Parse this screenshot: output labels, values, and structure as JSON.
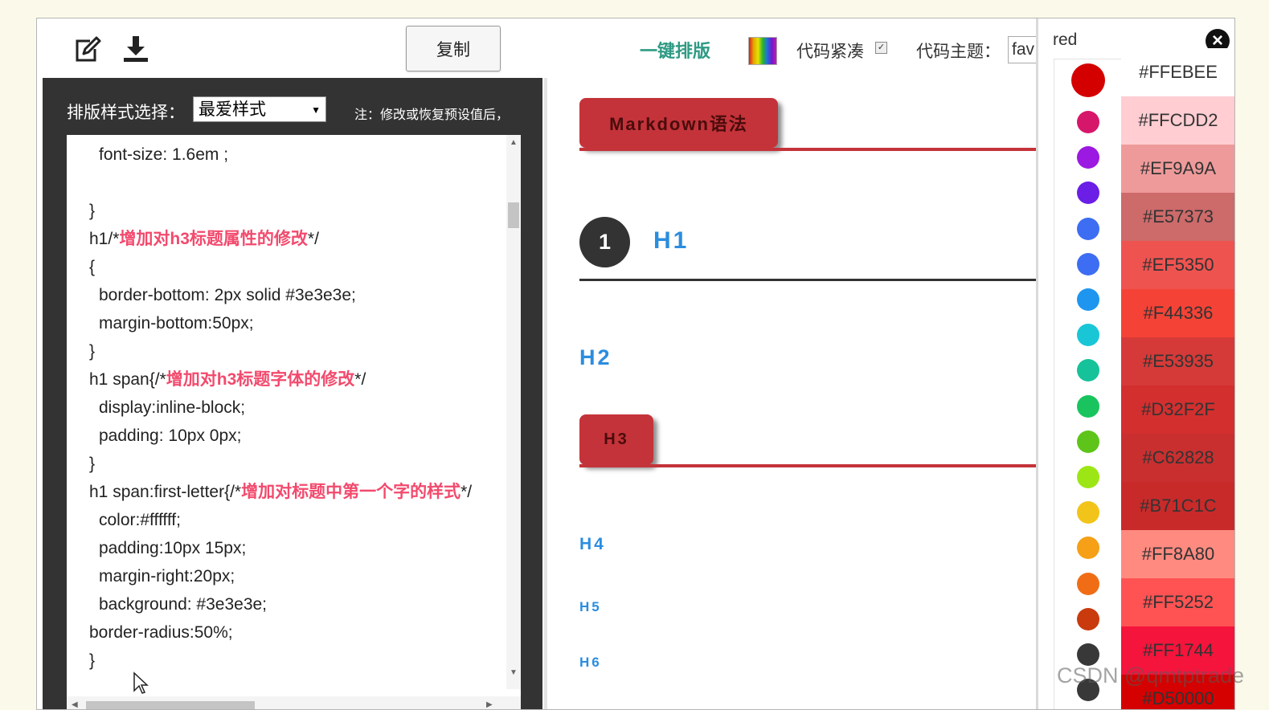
{
  "toolbar": {
    "edit_icon": "edit-icon",
    "download_icon": "download-icon",
    "copy_label": "复制",
    "one_key_label": "一键排版",
    "palette_icon": "palette-icon",
    "compact_label": "代码紧凑",
    "compact_checked": true,
    "theme_label": "代码主题：",
    "theme_value": "fav"
  },
  "editor": {
    "style_label": "排版样式选择：",
    "style_value": "最爱样式",
    "note": "注：修改或恢复预设值后，",
    "code_lines": [
      {
        "pre": "  font-size: 1.6em  ;",
        "red": "",
        "post": ""
      },
      {
        "pre": "",
        "red": "",
        "post": ""
      },
      {
        "pre": "}",
        "red": "",
        "post": ""
      },
      {
        "pre": "h1/*",
        "red": "增加对h3标题属性的修改",
        "post": "*/"
      },
      {
        "pre": "{",
        "red": "",
        "post": ""
      },
      {
        "pre": "  border-bottom: 2px solid #3e3e3e;",
        "red": "",
        "post": ""
      },
      {
        "pre": "  margin-bottom:50px;",
        "red": "",
        "post": ""
      },
      {
        "pre": "}",
        "red": "",
        "post": ""
      },
      {
        "pre": "h1 span{/*",
        "red": "增加对h3标题字体的修改",
        "post": "*/"
      },
      {
        "pre": "  display:inline-block;",
        "red": "",
        "post": ""
      },
      {
        "pre": "  padding:  10px  0px;",
        "red": "",
        "post": ""
      },
      {
        "pre": "}",
        "red": "",
        "post": ""
      },
      {
        "pre": "h1 span:first-letter{/*",
        "red": "增加对标题中第一个字的样式",
        "post": "*/"
      },
      {
        "pre": "  color:#ffffff;",
        "red": "",
        "post": ""
      },
      {
        "pre": "  padding:10px 15px;",
        "red": "",
        "post": ""
      },
      {
        "pre": "  margin-right:20px;",
        "red": "",
        "post": ""
      },
      {
        "pre": "  background: #3e3e3e;",
        "red": "",
        "post": ""
      },
      {
        "pre": "border-radius:50%;",
        "red": "",
        "post": ""
      },
      {
        "pre": "}",
        "red": "",
        "post": ""
      }
    ]
  },
  "preview": {
    "md_badge": "Markdown语法",
    "h1_number": "1",
    "h1": "H1",
    "h2": "H2",
    "h3": "H3",
    "h4": "H4",
    "h5": "H5",
    "h6": "H6"
  },
  "color_panel": {
    "palette_name": "red",
    "close_icon": "close-icon",
    "dots": [
      "#d40000",
      "#d6166b",
      "#9b19e0",
      "#6a1ee6",
      "#3d6df2",
      "#3d6df2",
      "#1e96f0",
      "#19c6d6",
      "#16c29a",
      "#19c45f",
      "#5ec41a",
      "#9de616",
      "#f2c41a",
      "#f5a017",
      "#f06d16",
      "#c93a0d",
      "#383838",
      "#383838"
    ],
    "swatches": [
      {
        "label": "#FFEBEE",
        "bg": "#FFFFFF"
      },
      {
        "label": "#FFCDD2",
        "bg": "#FFCDD2"
      },
      {
        "label": "#EF9A9A",
        "bg": "#EF9A9A"
      },
      {
        "label": "#E57373",
        "bg": "#CD6A6A"
      },
      {
        "label": "#EF5350",
        "bg": "#EF5350"
      },
      {
        "label": "#F44336",
        "bg": "#F44336"
      },
      {
        "label": "#E53935",
        "bg": "#D53A38"
      },
      {
        "label": "#D32F2F",
        "bg": "#D32F2F"
      },
      {
        "label": "#C62828",
        "bg": "#C92F2F"
      },
      {
        "label": "#B71C1C",
        "bg": "#C82A2A"
      },
      {
        "label": "#FF8A80",
        "bg": "#FF8A80"
      },
      {
        "label": "#FF5252",
        "bg": "#FF5252"
      },
      {
        "label": "#FF1744",
        "bg": "#F5143C"
      },
      {
        "label": "#D50000",
        "bg": "#D50000"
      }
    ]
  },
  "watermark": "CSDN @qmtptrade"
}
